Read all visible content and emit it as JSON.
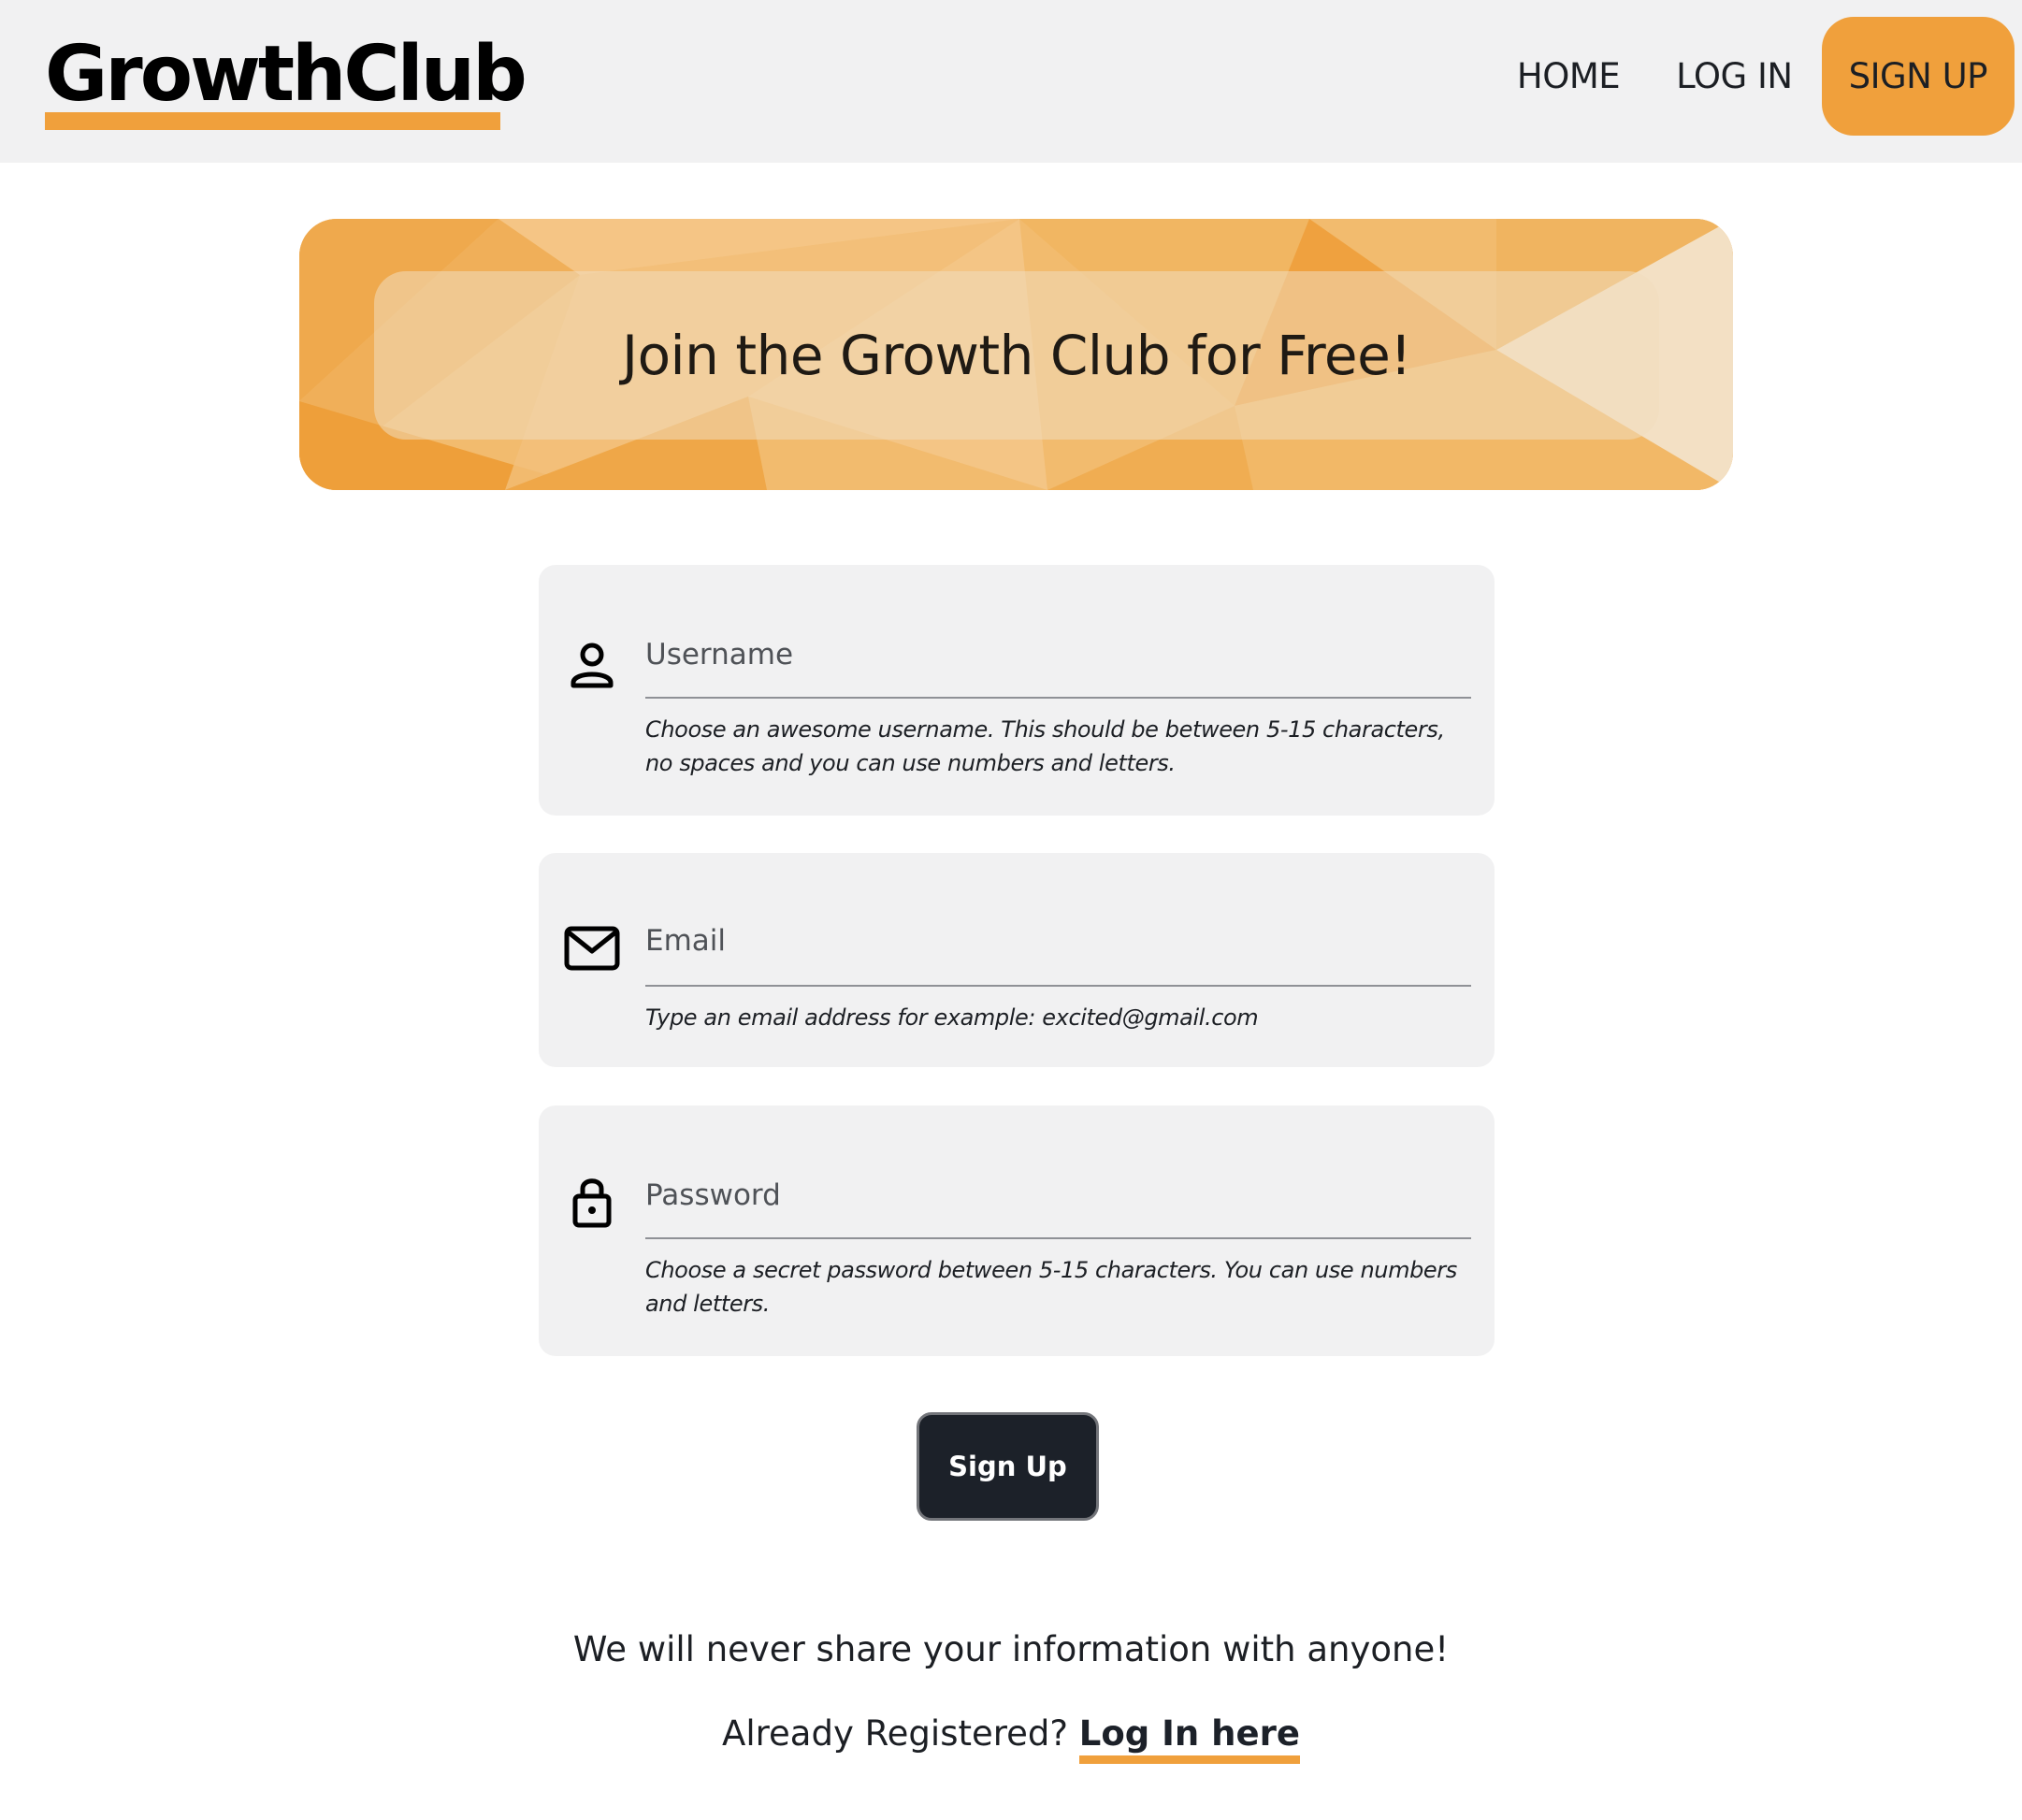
{
  "brand": {
    "name": "GrowthClub",
    "accent_color": "#f0a03c",
    "dark_color": "#1c2129"
  },
  "nav": {
    "home": "HOME",
    "login": "LOG IN",
    "signup": "SIGN UP"
  },
  "banner": {
    "title": "Join the Growth Club for Free!"
  },
  "form": {
    "username": {
      "icon": "user-icon",
      "placeholder": "Username",
      "help": "Choose an awesome username. This should be between 5-15 characters, no spaces and you can use numbers and letters."
    },
    "email": {
      "icon": "envelope-icon",
      "placeholder": "Email",
      "help": "Type an email address for example: excited@gmail.com"
    },
    "password": {
      "icon": "lock-icon",
      "placeholder": "Password",
      "help": "Choose a secret password between 5-15 characters. You can use numbers and letters."
    },
    "submit_label": "Sign Up"
  },
  "footer": {
    "privacy": "We will never share your information with anyone!",
    "already_registered": "Already Registered?",
    "login_link": "Log In here"
  }
}
